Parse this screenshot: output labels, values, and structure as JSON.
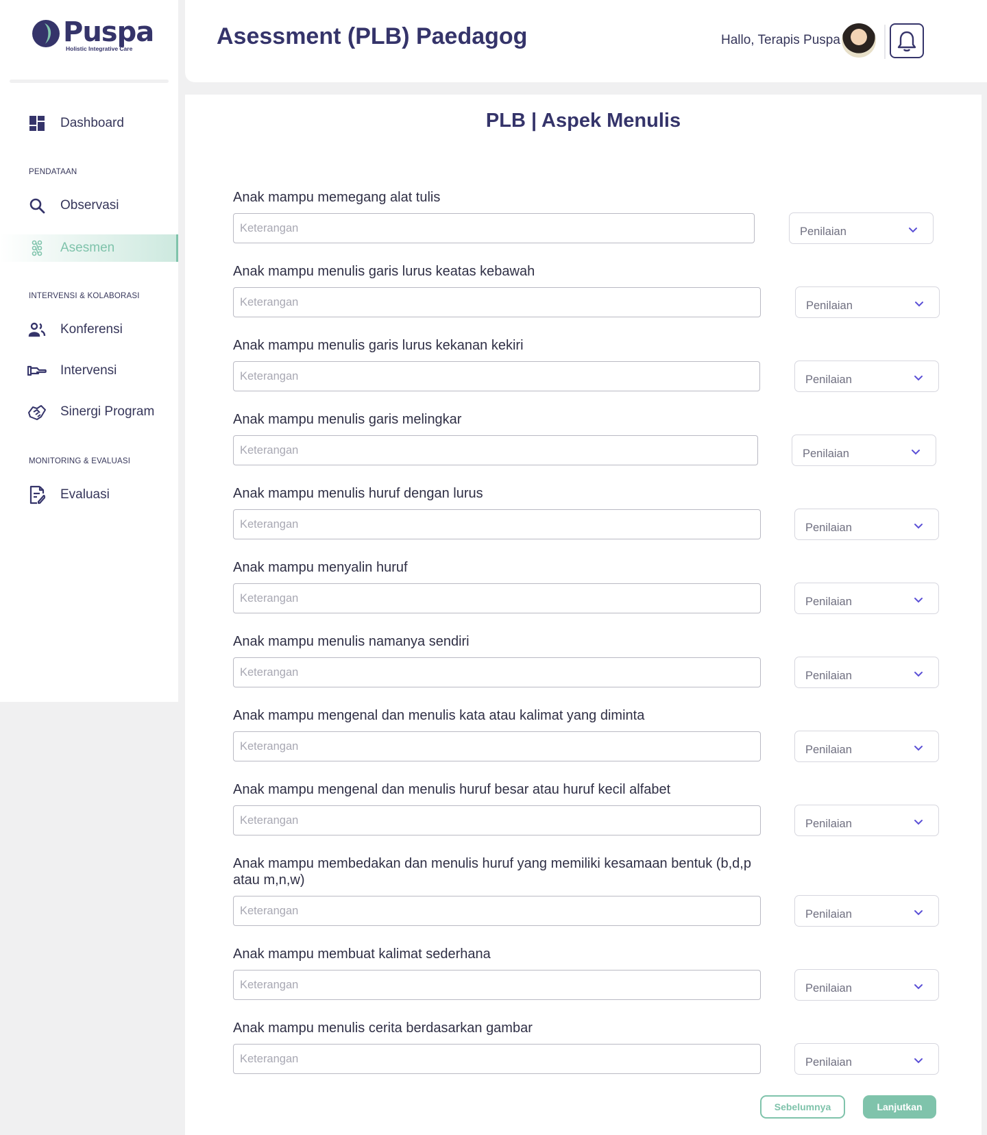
{
  "brand": {
    "name": "Puspa",
    "tagline": "Holistic Integrative Care",
    "accent": "#7fc3ab",
    "primary": "#35346a"
  },
  "sidebar": {
    "dashboard": {
      "label": "Dashboard",
      "icon": "dashboard-icon"
    },
    "sections": {
      "pendataan": "PENDATAAN",
      "intervensi": "INTERVENSI & KOLABORASI",
      "monitoring": "MONITORING & EVALUASI"
    },
    "items": {
      "observasi": {
        "label": "Observasi",
        "icon": "search-icon"
      },
      "asesmen": {
        "label": "Asesmen",
        "icon": "asesmen-icon",
        "active": true
      },
      "konferensi": {
        "label": "Konferensi",
        "icon": "users-icon"
      },
      "intervensi": {
        "label": "Intervensi",
        "icon": "hand-icon"
      },
      "sinergi": {
        "label": "Sinergi Program",
        "icon": "handshake-icon"
      },
      "evaluasi": {
        "label": "Evaluasi",
        "icon": "document-edit-icon"
      }
    }
  },
  "header": {
    "title": "Asessment (PLB) Paedagog",
    "greeting": "Hallo, Terapis Puspa"
  },
  "form": {
    "section_title": "PLB | Aspek Menulis",
    "input_placeholder": "Keterangan",
    "select_placeholder": "Penilaian",
    "questions": [
      "Anak mampu memegang alat tulis",
      "Anak mampu menulis garis lurus keatas kebawah",
      "Anak mampu menulis garis lurus kekanan kekiri",
      "Anak mampu menulis garis melingkar",
      "Anak mampu menulis huruf dengan lurus",
      "Anak mampu menyalin huruf",
      "Anak mampu menulis namanya sendiri",
      "Anak mampu mengenal dan menulis kata atau kalimat yang diminta",
      "Anak mampu mengenal dan menulis huruf besar atau huruf kecil alfabet",
      "Anak mampu membedakan dan menulis huruf yang memiliki kesamaan bentuk (b,d,p atau m,n,w)",
      "Anak mampu membuat kalimat sederhana",
      "Anak mampu menulis cerita berdasarkan gambar"
    ],
    "prev_label": "Sebelumnya",
    "next_label": "Lanjutkan"
  }
}
